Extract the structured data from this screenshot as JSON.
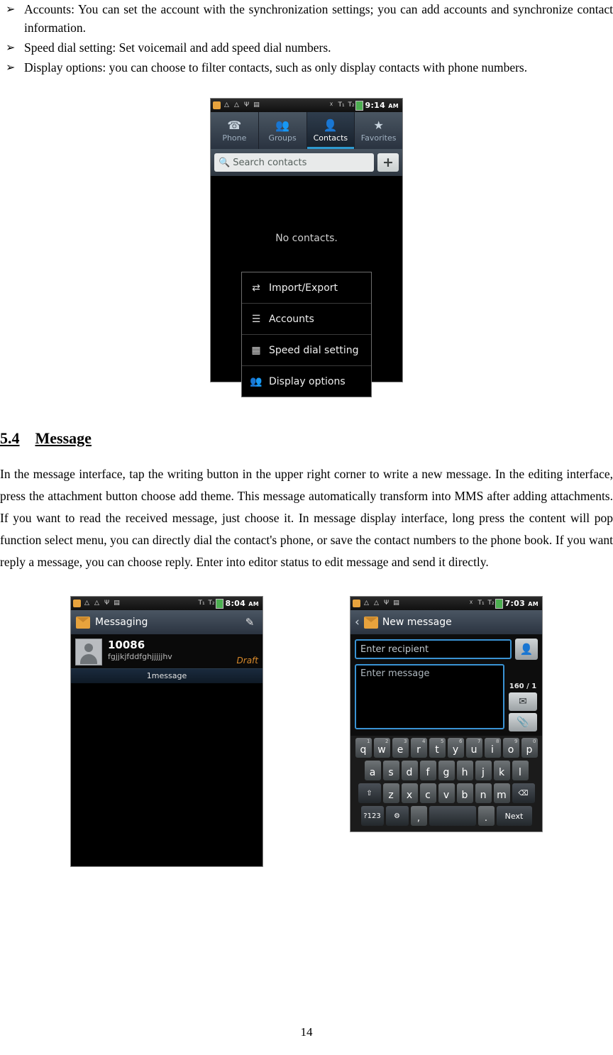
{
  "bullets": [
    {
      "marker": "➢",
      "text": "Accounts: You can set the account with the synchronization settings; you can add accounts and synchronize contact information."
    },
    {
      "marker": "➢",
      "text": "Speed dial setting: Set voicemail and add speed dial numbers."
    },
    {
      "marker": "➢",
      "text": "Display options: you can choose to filter contacts, such as only display contacts with phone numbers."
    }
  ],
  "contacts_screen": {
    "status_bar": {
      "time": "9:14",
      "ampm": "AM"
    },
    "tabs": [
      {
        "label": "Phone",
        "icon": "phone-icon",
        "active": false
      },
      {
        "label": "Groups",
        "icon": "groups-icon",
        "active": false
      },
      {
        "label": "Contacts",
        "icon": "contact-icon",
        "active": true
      },
      {
        "label": "Favorites",
        "icon": "star-icon",
        "active": false
      }
    ],
    "search_placeholder": "Search contacts",
    "add_label": "+",
    "empty_text": "No contacts.",
    "menu": [
      {
        "label": "Import/Export",
        "icon": "import-export-icon"
      },
      {
        "label": "Accounts",
        "icon": "accounts-icon"
      },
      {
        "label": "Speed dial setting",
        "icon": "speed-dial-icon"
      },
      {
        "label": "Display options",
        "icon": "display-options-icon"
      }
    ]
  },
  "section": {
    "number": "5.4",
    "title": "Message",
    "paragraph": "In the message interface, tap the writing button in the upper right corner to write a new message. In the editing interface, press the attachment button choose add theme. This message automatically transform into MMS after adding attachments. If you want to read the received message, just choose it. In message display interface, long press the content will pop function select menu, you can directly dial the contact's phone, or save the contact numbers to the phone book. If you want reply a message, you can choose reply. Enter into editor status to edit message and send it directly."
  },
  "messaging_screen": {
    "status_bar": {
      "time": "8:04",
      "ampm": "AM"
    },
    "title": "Messaging",
    "compose_icon": "compose-icon",
    "conversation": {
      "number": "10086",
      "snippet": "fgjjkjfddfghjjjjjhv",
      "draft_label": "Draft",
      "count_label": "1message"
    }
  },
  "new_message_screen": {
    "status_bar": {
      "time": "7:03",
      "ampm": "AM"
    },
    "title": "New message",
    "recipient_placeholder": "Enter recipient",
    "message_placeholder": "Enter message",
    "counter": "160 / 1",
    "send_icon": "send-icon",
    "attach_icon": "paperclip-icon",
    "keyboard": {
      "row1": [
        {
          "key": "q",
          "sup": "1"
        },
        {
          "key": "w",
          "sup": "2"
        },
        {
          "key": "e",
          "sup": "3"
        },
        {
          "key": "r",
          "sup": "4"
        },
        {
          "key": "t",
          "sup": "5"
        },
        {
          "key": "y",
          "sup": "6"
        },
        {
          "key": "u",
          "sup": "7"
        },
        {
          "key": "i",
          "sup": "8"
        },
        {
          "key": "o",
          "sup": "9"
        },
        {
          "key": "p",
          "sup": "0"
        }
      ],
      "row2": [
        {
          "key": "a"
        },
        {
          "key": "s"
        },
        {
          "key": "d"
        },
        {
          "key": "f"
        },
        {
          "key": "g"
        },
        {
          "key": "h"
        },
        {
          "key": "j"
        },
        {
          "key": "k"
        },
        {
          "key": "l"
        }
      ],
      "row3_shift": "⇧",
      "row3": [
        {
          "key": "z"
        },
        {
          "key": "x"
        },
        {
          "key": "c"
        },
        {
          "key": "v"
        },
        {
          "key": "b"
        },
        {
          "key": "n"
        },
        {
          "key": "m"
        }
      ],
      "row3_backspace": "⌫",
      "row4": {
        "symbols": "?123",
        "settings": "⚙",
        "comma": ",",
        "space": "",
        "period": ".",
        "next": "Next"
      }
    }
  },
  "page_number": "14"
}
